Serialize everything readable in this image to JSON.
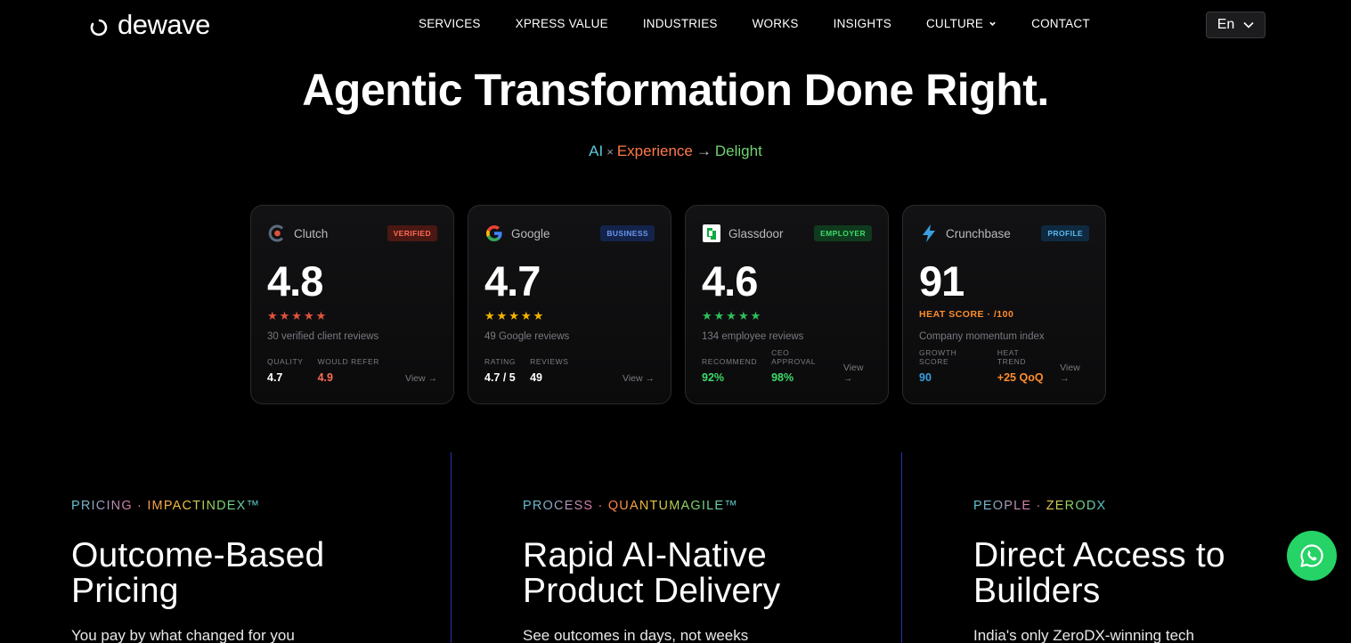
{
  "brand": {
    "name": "dewave"
  },
  "nav": {
    "items": [
      {
        "label": "SERVICES"
      },
      {
        "label": "XPRESS VALUE"
      },
      {
        "label": "INDUSTRIES"
      },
      {
        "label": "WORKS"
      },
      {
        "label": "INSIGHTS"
      },
      {
        "label": "CULTURE"
      },
      {
        "label": "CONTACT"
      }
    ],
    "language": "En"
  },
  "hero": {
    "title": "Agentic Transformation Done Right.",
    "tagline": {
      "ai": "AI",
      "times": "×",
      "experience": "Experience",
      "arrow": "→",
      "delight": "Delight"
    }
  },
  "cards": [
    {
      "brand": "Clutch",
      "badge": "VERIFIED",
      "badge_color": "#e0533d",
      "score": "4.8",
      "stars": "★★★★★",
      "star_color": "#e0533d",
      "desc": "30 verified client reviews",
      "metrics": [
        {
          "label": "QUALITY",
          "value": "4.7",
          "color": "#ffffff"
        },
        {
          "label": "WOULD REFER",
          "value": "4.9",
          "color": "#ff6b57"
        }
      ],
      "view": "View →"
    },
    {
      "brand": "Google",
      "badge": "BUSINESS",
      "badge_color": "#4c7bdc",
      "score": "4.7",
      "stars": "★★★★★",
      "star_color": "#f5b400",
      "desc": "49 Google reviews",
      "metrics": [
        {
          "label": "RATING",
          "value": "4.7 / 5",
          "color": "#ffffff"
        },
        {
          "label": "REVIEWS",
          "value": "49",
          "color": "#ffffff"
        }
      ],
      "view": "View →"
    },
    {
      "brand": "Glassdoor",
      "badge": "EMPLOYER",
      "badge_color": "#2fbf5b",
      "score": "4.6",
      "stars": "★★★★★",
      "star_color": "#2fbf5b",
      "desc": "134 employee reviews",
      "metrics": [
        {
          "label": "RECOMMEND",
          "value": "92%",
          "color": "#3ddc6a"
        },
        {
          "label": "CEO APPROVAL",
          "value": "98%",
          "color": "#3ddc6a"
        }
      ],
      "view": "View →"
    },
    {
      "brand": "Crunchbase",
      "badge": "PROFILE",
      "badge_color": "#3aa0e0",
      "score": "91",
      "heat_label": "HEAT SCORE · /100",
      "desc": "Company momentum index",
      "metrics": [
        {
          "label": "GROWTH SCORE",
          "value": "90",
          "color": "#3aa0e0"
        },
        {
          "label": "HEAT TREND",
          "value": "+25 QoQ",
          "color": "#ff8c2a"
        }
      ],
      "view": "View →"
    }
  ],
  "columns": [
    {
      "kicker_a": "PRICING",
      "kicker_sep": " · ",
      "kicker_b": "IMPACTINDEX™",
      "title": "Outcome-Based Pricing",
      "text": "You pay by what changed for you"
    },
    {
      "kicker_a": "PROCESS",
      "kicker_sep": " · ",
      "kicker_b": "QUANTUMAGILE™",
      "title": "Rapid AI-Native Product Delivery",
      "text": "See outcomes in days, not weeks"
    },
    {
      "kicker_a": "PEOPLE",
      "kicker_sep": " · ",
      "kicker_b": "ZERODX",
      "title": "Direct Access to Builders",
      "text": "India's only ZeroDX-winning tech"
    }
  ]
}
